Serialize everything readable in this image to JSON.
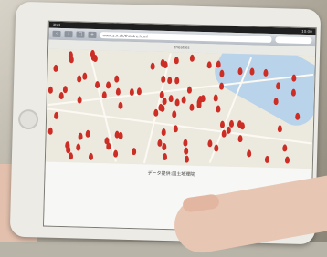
{
  "statusbar": {
    "left": "iPad",
    "right": "10:00"
  },
  "browser": {
    "url": "www.a.n.sh/theatre.html",
    "page_title": "theatres"
  },
  "map": {
    "caption": "データ提供:国土地理院"
  }
}
